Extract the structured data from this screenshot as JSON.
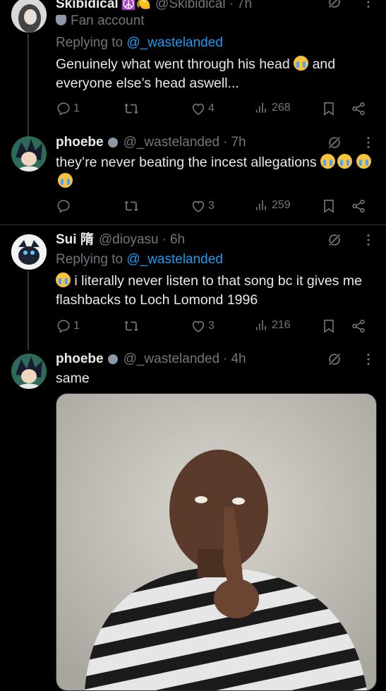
{
  "tweets": [
    {
      "name": "Skibidical",
      "name_emojis": "☮️🍋",
      "handle": "@Skibidical",
      "time": "7h",
      "label": "Fan account",
      "replying_prefix": "Replying to",
      "replying_to": "@_wastelanded",
      "text_a": "Genuinely what went through his head",
      "text_b": "and everyone else’s head aswell...",
      "replies": "1",
      "retweets": "",
      "likes": "4",
      "views": "268"
    },
    {
      "name": "phoebe",
      "handle": "@_wastelanded",
      "time": "7h",
      "text": "they’re never beating the incest allegations",
      "replies": "",
      "retweets": "",
      "likes": "3",
      "views": "259"
    },
    {
      "name": "Sui 隋",
      "handle": "@dioyasu",
      "time": "6h",
      "replying_prefix": "Replying to",
      "replying_to": "@_wastelanded",
      "text": "i literally never listen to that song bc it gives me flashbacks to Loch Lomond 1996",
      "replies": "1",
      "retweets": "",
      "likes": "3",
      "views": "216"
    },
    {
      "name": "phoebe",
      "handle": "@_wastelanded",
      "time": "4h",
      "text": "same"
    }
  ],
  "separator": "·",
  "icons": [
    "reply-icon",
    "retweet-icon",
    "like-icon",
    "views-icon",
    "bookmark-icon",
    "share-icon",
    "grok-icon",
    "more-icon"
  ]
}
